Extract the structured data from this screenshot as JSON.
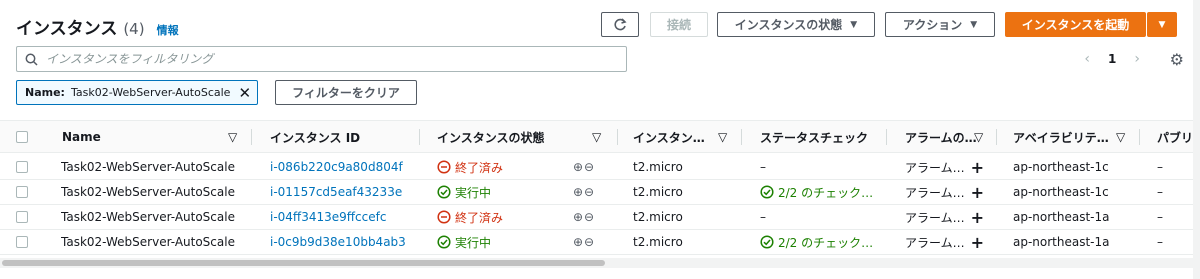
{
  "header": {
    "title": "インスタンス",
    "count": "(4)",
    "info": "情報"
  },
  "toolbar": {
    "refresh_icon": "refresh-icon",
    "connect": "接続",
    "state": "インスタンスの状態",
    "actions": "アクション",
    "launch": "インスタンスを起動",
    "caret": "▼"
  },
  "search": {
    "placeholder": "インスタンスをフィルタリング"
  },
  "pagination": {
    "prev": "‹",
    "page": "1",
    "next": "›"
  },
  "filter": {
    "key": "Name:",
    "value": "Task02-WebServer-AutoScale",
    "clear": "フィルターをクリア"
  },
  "columns": [
    "Name",
    "インスタンス ID",
    "インスタンスの状態",
    "インスタン…",
    "ステータスチェック",
    "アラームの…",
    "アベイラビリテ…",
    "パブリ"
  ],
  "rows": [
    {
      "name": "Task02-WebServer-AutoScale",
      "id": "i-086b220c9a80d804f",
      "state": "終了済み",
      "type": "t2.micro",
      "status": "–",
      "alarm": "アラーム…",
      "az": "ap-northeast-1c",
      "public": "–"
    },
    {
      "name": "Task02-WebServer-AutoScale",
      "id": "i-01157cd5eaf43233e",
      "state": "実行中",
      "type": "t2.micro",
      "status": "2/2 のチェック…",
      "alarm": "アラーム…",
      "az": "ap-northeast-1c",
      "public": "–"
    },
    {
      "name": "Task02-WebServer-AutoScale",
      "id": "i-04ff3413e9ffccefc",
      "state": "終了済み",
      "type": "t2.micro",
      "status": "–",
      "alarm": "アラーム…",
      "az": "ap-northeast-1a",
      "public": "–"
    },
    {
      "name": "Task02-WebServer-AutoScale",
      "id": "i-0c9b9d38e10bb4ab3",
      "state": "実行中",
      "type": "t2.micro",
      "status": "2/2 のチェック…",
      "alarm": "アラーム…",
      "az": "ap-northeast-1a",
      "public": "–"
    }
  ],
  "colors": {
    "accent": "#ec7211",
    "link": "#0073bb",
    "stopped": "#d13212",
    "running": "#1d8102"
  }
}
